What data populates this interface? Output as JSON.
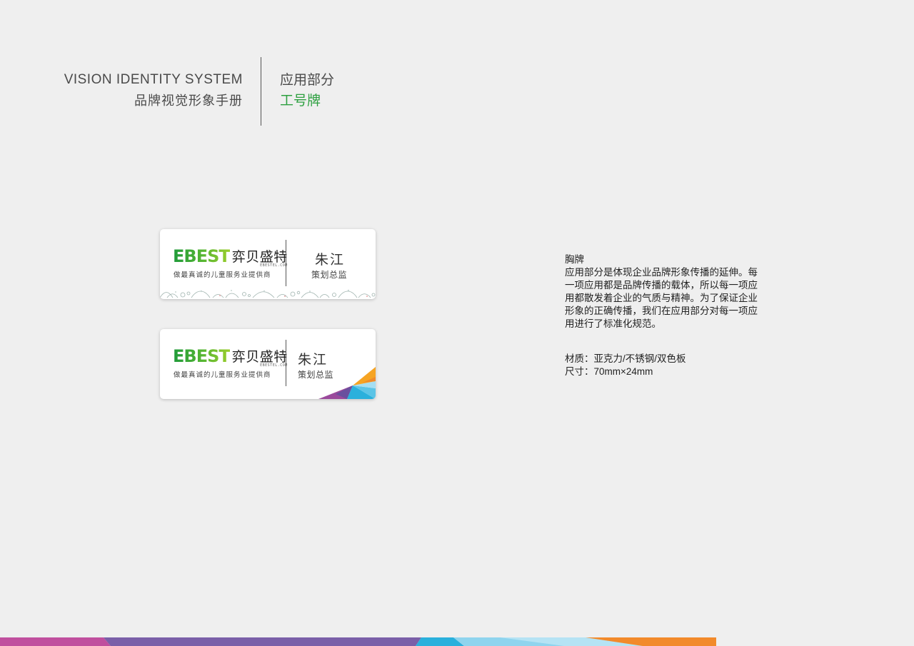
{
  "header": {
    "title_en": "VISION IDENTITY SYSTEM",
    "title_cn": "品牌视觉形象手册",
    "section": "应用部分",
    "page": "工号牌"
  },
  "badges": [
    {
      "logo_en": "EBEST",
      "logo_cn": "弈贝盛特",
      "domain": "EBESTEL.COM",
      "slogan": "做最真诚的儿童服务业提供商",
      "name": "朱江",
      "title": "策划总监",
      "decoration": "floral-border"
    },
    {
      "logo_en": "EBEST",
      "logo_cn": "弈贝盛特",
      "domain": "EBESTEL.COM",
      "slogan": "做最真诚的儿童服务业提供商",
      "name": "朱江",
      "title": "策划总监",
      "decoration": "color-triangles"
    }
  ],
  "description": {
    "heading": "胸牌",
    "body": "应用部分是体现企业品牌形象传播的延伸。每一项应用都是品牌传播的载体，所以每一项应用都散发着企业的气质与精神。为了保证企业形象的正确传播，我们在应用部分对每一项应用进行了标准化规范。"
  },
  "specs": {
    "material": "材质：亚克力/不锈钢/双色板",
    "size": "尺寸：70mm×24mm"
  },
  "colors": {
    "accent_green": "#2da040",
    "bar": [
      "#c04f9e",
      "#7a5fa8",
      "#2ab0dc",
      "#8fd4ee",
      "#f28a2b"
    ]
  }
}
